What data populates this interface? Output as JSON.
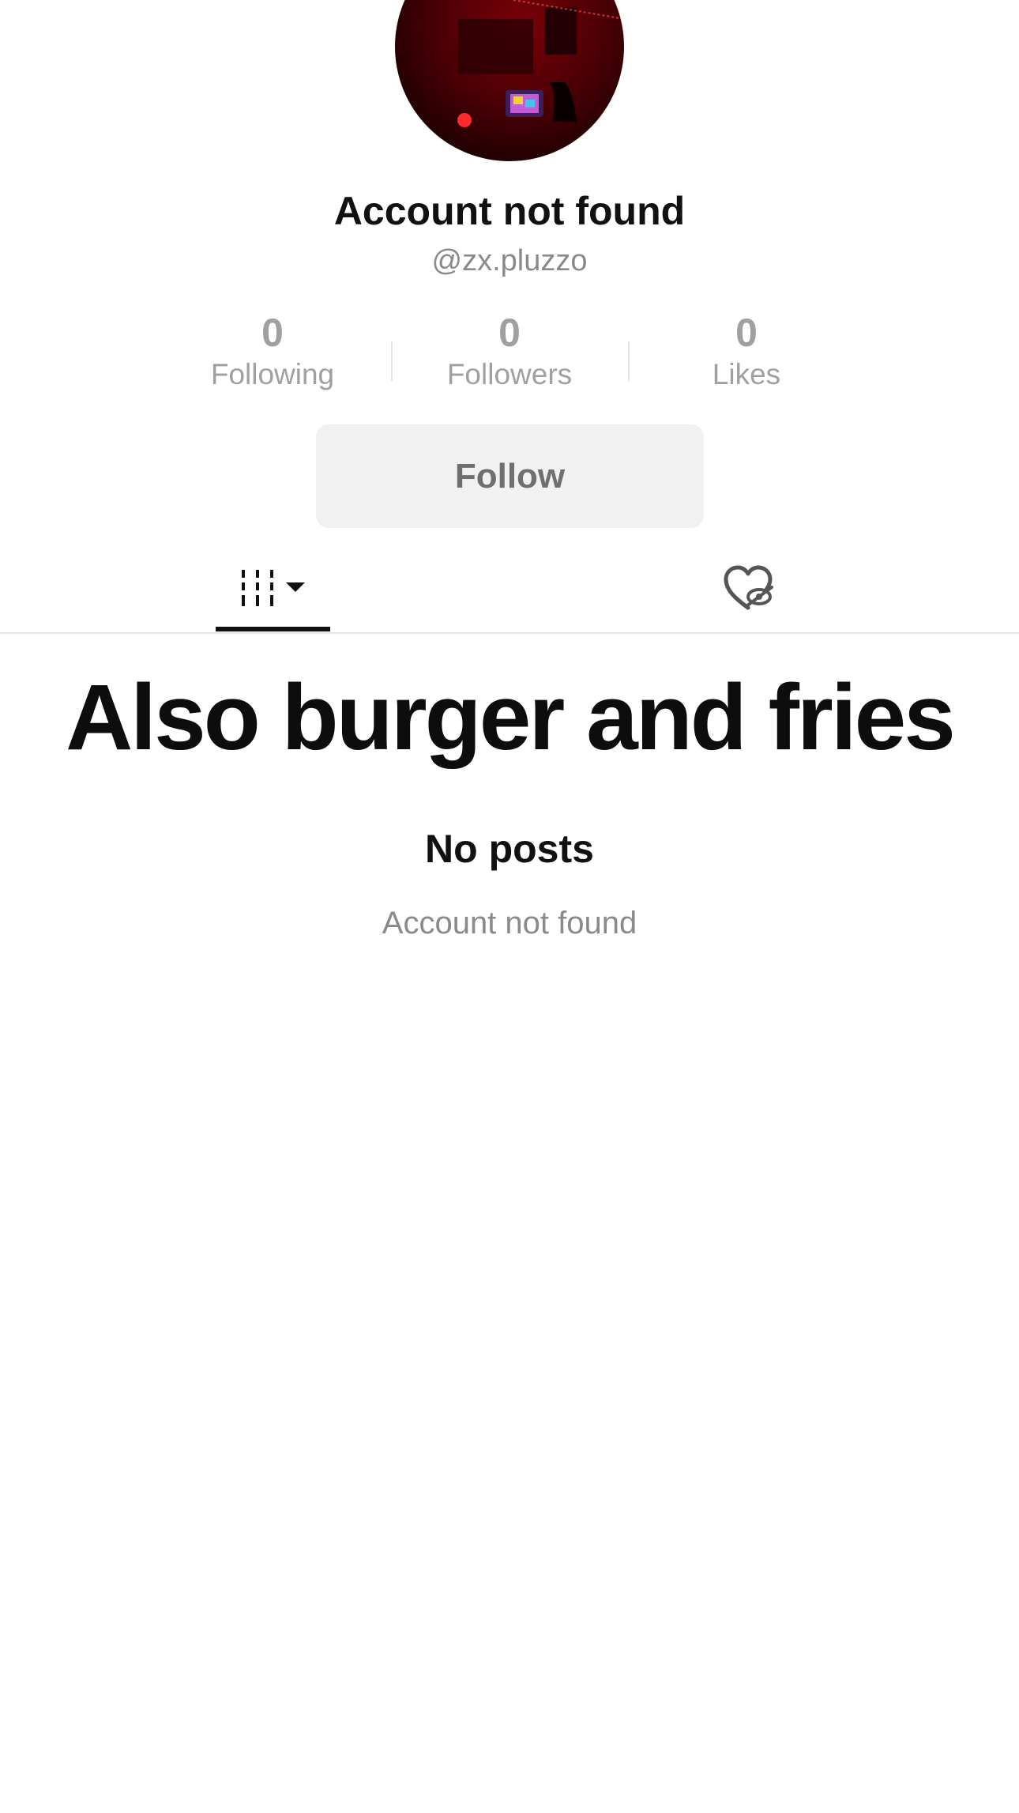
{
  "profile": {
    "display_name": "Account not found",
    "username": "@zx.pluzzo",
    "avatar_icon": "profile-photo"
  },
  "stats": [
    {
      "value": "0",
      "label": "Following"
    },
    {
      "value": "0",
      "label": "Followers"
    },
    {
      "value": "0",
      "label": "Likes"
    }
  ],
  "actions": {
    "follow_label": "Follow"
  },
  "tabs": [
    {
      "icon": "videos-grid-icon",
      "active": true
    },
    {
      "icon": "liked-hidden-heart-icon",
      "active": false
    }
  ],
  "overlay": {
    "caption": "Also burger and fries"
  },
  "empty_state": {
    "title": "No posts",
    "subtitle": "Account not found"
  },
  "colors": {
    "muted_text": "#8a8a8a",
    "button_bg": "#f1f1f1",
    "active_tab_indicator": "#111111"
  }
}
